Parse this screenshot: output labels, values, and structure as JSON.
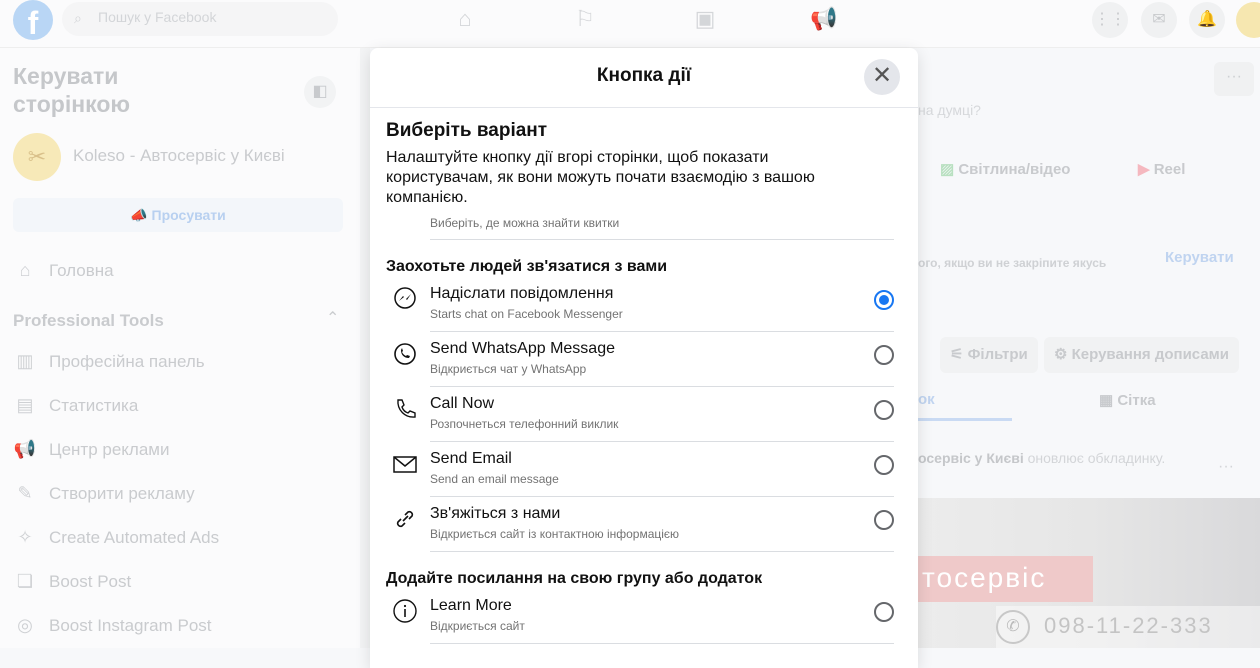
{
  "topbar": {
    "search_placeholder": "Пошук у Facebook"
  },
  "sidebar": {
    "title": "Керувати сторінкою",
    "page_name": "Koleso - Автосервіс у Києві",
    "promote": "Просувати",
    "home": "Головна",
    "pro_tools": "Professional Tools",
    "items": [
      {
        "label": "Професійна панель",
        "icon": "dashboard-icon"
      },
      {
        "label": "Статистика",
        "icon": "insights-icon"
      },
      {
        "label": "Центр реклами",
        "icon": "megaphone-icon"
      },
      {
        "label": "Створити рекламу",
        "icon": "edit-icon"
      },
      {
        "label": "Create Automated Ads",
        "icon": "magic-wand-icon"
      },
      {
        "label": "Boost Post",
        "icon": "boost-icon"
      },
      {
        "label": "Boost Instagram Post",
        "icon": "instagram-icon"
      }
    ]
  },
  "background": {
    "whats_on_mind": "на думці?",
    "photo_video": "Світлина/відео",
    "reel": "Reel",
    "pinned_text": "ого, якщо ви не закріпите якусь",
    "manage": "Керувати",
    "filters": "Фільтри",
    "manage_posts": "Керування дописами",
    "tab_list": "ок",
    "tab_grid": "Сітка",
    "post_author": "осервіс у Києві",
    "post_action": "оновлює обкладинку.",
    "cover_text": "тосервіс",
    "cover_phone": "098-11-22-333"
  },
  "modal": {
    "title": "Кнопка дії",
    "heading": "Виберіть варіант",
    "description": "Налаштуйте кнопку дії вгорі сторінки, щоб показати користувачам, як вони можуть почати взаємодію з вашою компанією.",
    "clipped_subtitle": "Виберіть, де можна знайти квитки",
    "section1": "Заохотьте людей зв'язатися з вами",
    "options": [
      {
        "title": "Надіслати повідомлення",
        "subtitle": "Starts chat on Facebook Messenger",
        "icon": "messenger-icon",
        "selected": true
      },
      {
        "title": "Send WhatsApp Message",
        "subtitle": "Відкриється чат у WhatsApp",
        "icon": "whatsapp-icon",
        "selected": false
      },
      {
        "title": "Call Now",
        "subtitle": "Розпочнеться телефонний виклик",
        "icon": "phone-icon",
        "selected": false
      },
      {
        "title": "Send Email",
        "subtitle": "Send an email message",
        "icon": "email-icon",
        "selected": false
      },
      {
        "title": "Зв'яжіться з нами",
        "subtitle": "Відкриється сайт із контактною інформацією",
        "icon": "link-icon",
        "selected": false
      }
    ],
    "section2": "Додайте посилання на свою групу або додаток",
    "options2": [
      {
        "title": "Learn More",
        "subtitle": "Відкриється сайт",
        "icon": "info-icon",
        "selected": false
      }
    ],
    "accent": "#1877f2"
  }
}
